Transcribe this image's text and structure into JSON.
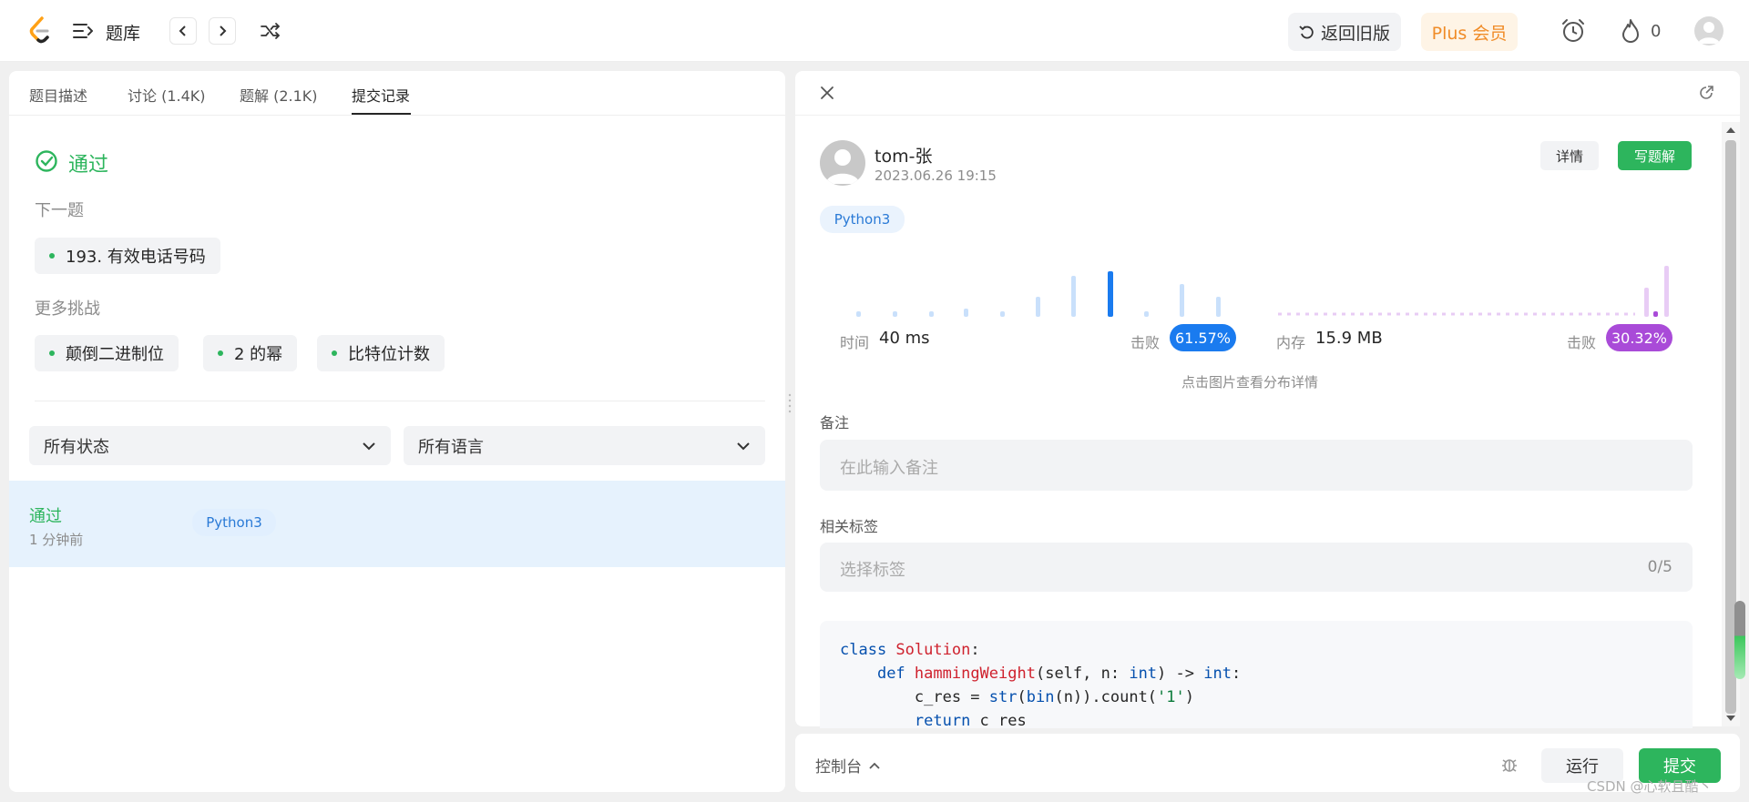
{
  "topbar": {
    "logo": "leetcode-logo",
    "menu_label": "题库",
    "back_old_label": "返回旧版",
    "plus_label": "Plus 会员",
    "streak_count": "0"
  },
  "left": {
    "tabs": [
      "题目描述",
      "讨论 (1.4K)",
      "题解 (2.1K)",
      "提交记录"
    ],
    "status_title": "通过",
    "next_label": "下一题",
    "next_item": "193. 有效电话号码",
    "more_label": "更多挑战",
    "challenges": [
      "颠倒二进制位",
      "2 的幂",
      "比特位计数"
    ],
    "filter_status": "所有状态",
    "filter_lang": "所有语言",
    "submission": {
      "status": "通过",
      "time": "1 分钟前",
      "lang": "Python3"
    }
  },
  "right": {
    "user_name": "tom-张",
    "submit_time": "2023.06.26 19:15",
    "detail_btn": "详情",
    "write_btn": "写题解",
    "lang": "Python3",
    "time_label": "时间",
    "time_value": "40 ms",
    "beat_label_1": "击败",
    "beat_time": "61.57%",
    "mem_label": "内存",
    "mem_value": "15.9 MB",
    "beat_label_2": "击败",
    "beat_mem": "30.32%",
    "chart_hint": "点击图片查看分布详情",
    "note_label": "备注",
    "note_placeholder": "在此输入备注",
    "tags_label": "相关标签",
    "tags_placeholder": "选择标签",
    "tags_count": "0/5",
    "code_lines": [
      "class Solution:",
      "    def hammingWeight(self, n: int) -> int:",
      "        c_res = str(bin(n)).count('1')",
      "        return c_res"
    ]
  },
  "bottom": {
    "console_label": "控制台",
    "run_label": "运行",
    "submit_label": "提交"
  },
  "watermark": "CSDN @心软且酷丶",
  "colors": {
    "accent_green": "#2db55d",
    "blue": "#1a7bef",
    "purple": "#a94bd8",
    "plus_orange": "#f08c28"
  }
}
